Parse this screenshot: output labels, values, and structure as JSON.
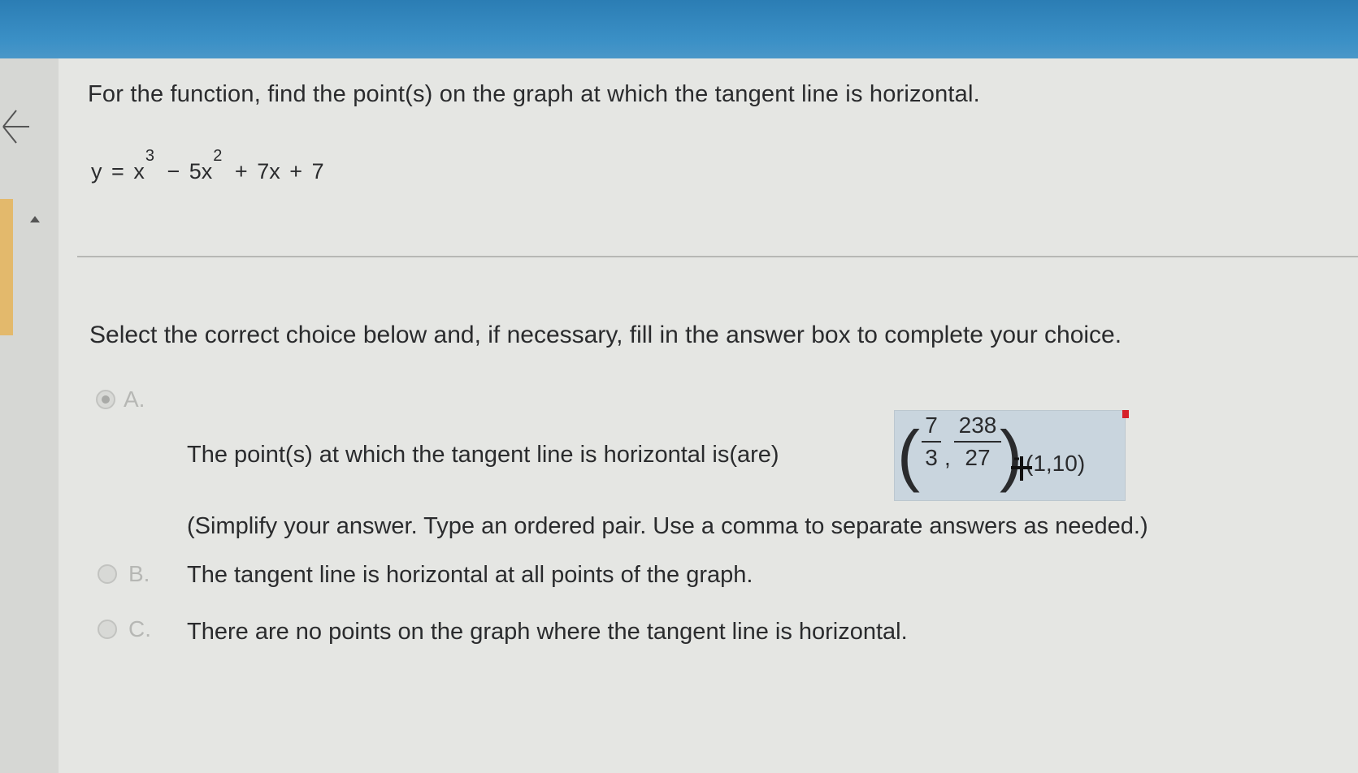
{
  "question": {
    "prompt": "For the function, find the point(s) on the graph at which the tangent line is horizontal.",
    "equation": {
      "lhs": "y",
      "eq": "=",
      "term1_base": "x",
      "term1_exp": "3",
      "op1": "−",
      "term2_base": "5x",
      "term2_exp": "2",
      "op2": "+",
      "term3": "7x",
      "op3": "+",
      "term4": "7"
    }
  },
  "instruction": "Select the correct choice below and, if necessary, fill in the answer box to complete your choice.",
  "choices": [
    {
      "letter": "A.",
      "selected": true,
      "text": "The point(s) at which the tangent line is horizontal is(are)",
      "answer": {
        "open_paren": "(",
        "frac1_num": "7",
        "frac1_den": "3",
        "comma": ",",
        "frac2_num": "238",
        "frac2_den": "27",
        "close_paren": ")",
        "second_pair": "(1,10)"
      },
      "hint": "(Simplify your answer. Type an ordered pair. Use a comma to separate answers as needed.)"
    },
    {
      "letter": "B.",
      "selected": false,
      "text": "The tangent line is horizontal at all points of the graph."
    },
    {
      "letter": "C.",
      "selected": false,
      "text": "There are no points on the graph where the tangent line is horizontal."
    }
  ],
  "colors": {
    "top_bar": "#3b90c6",
    "answer_box": "#c9d5de",
    "accent_strip": "#e3b96c",
    "flag": "#d6202a"
  },
  "icons": {
    "back": "back-arrow-icon",
    "collapse": "caret-up-icon",
    "cursor": "text-cursor-icon",
    "flag": "flag-icon"
  }
}
